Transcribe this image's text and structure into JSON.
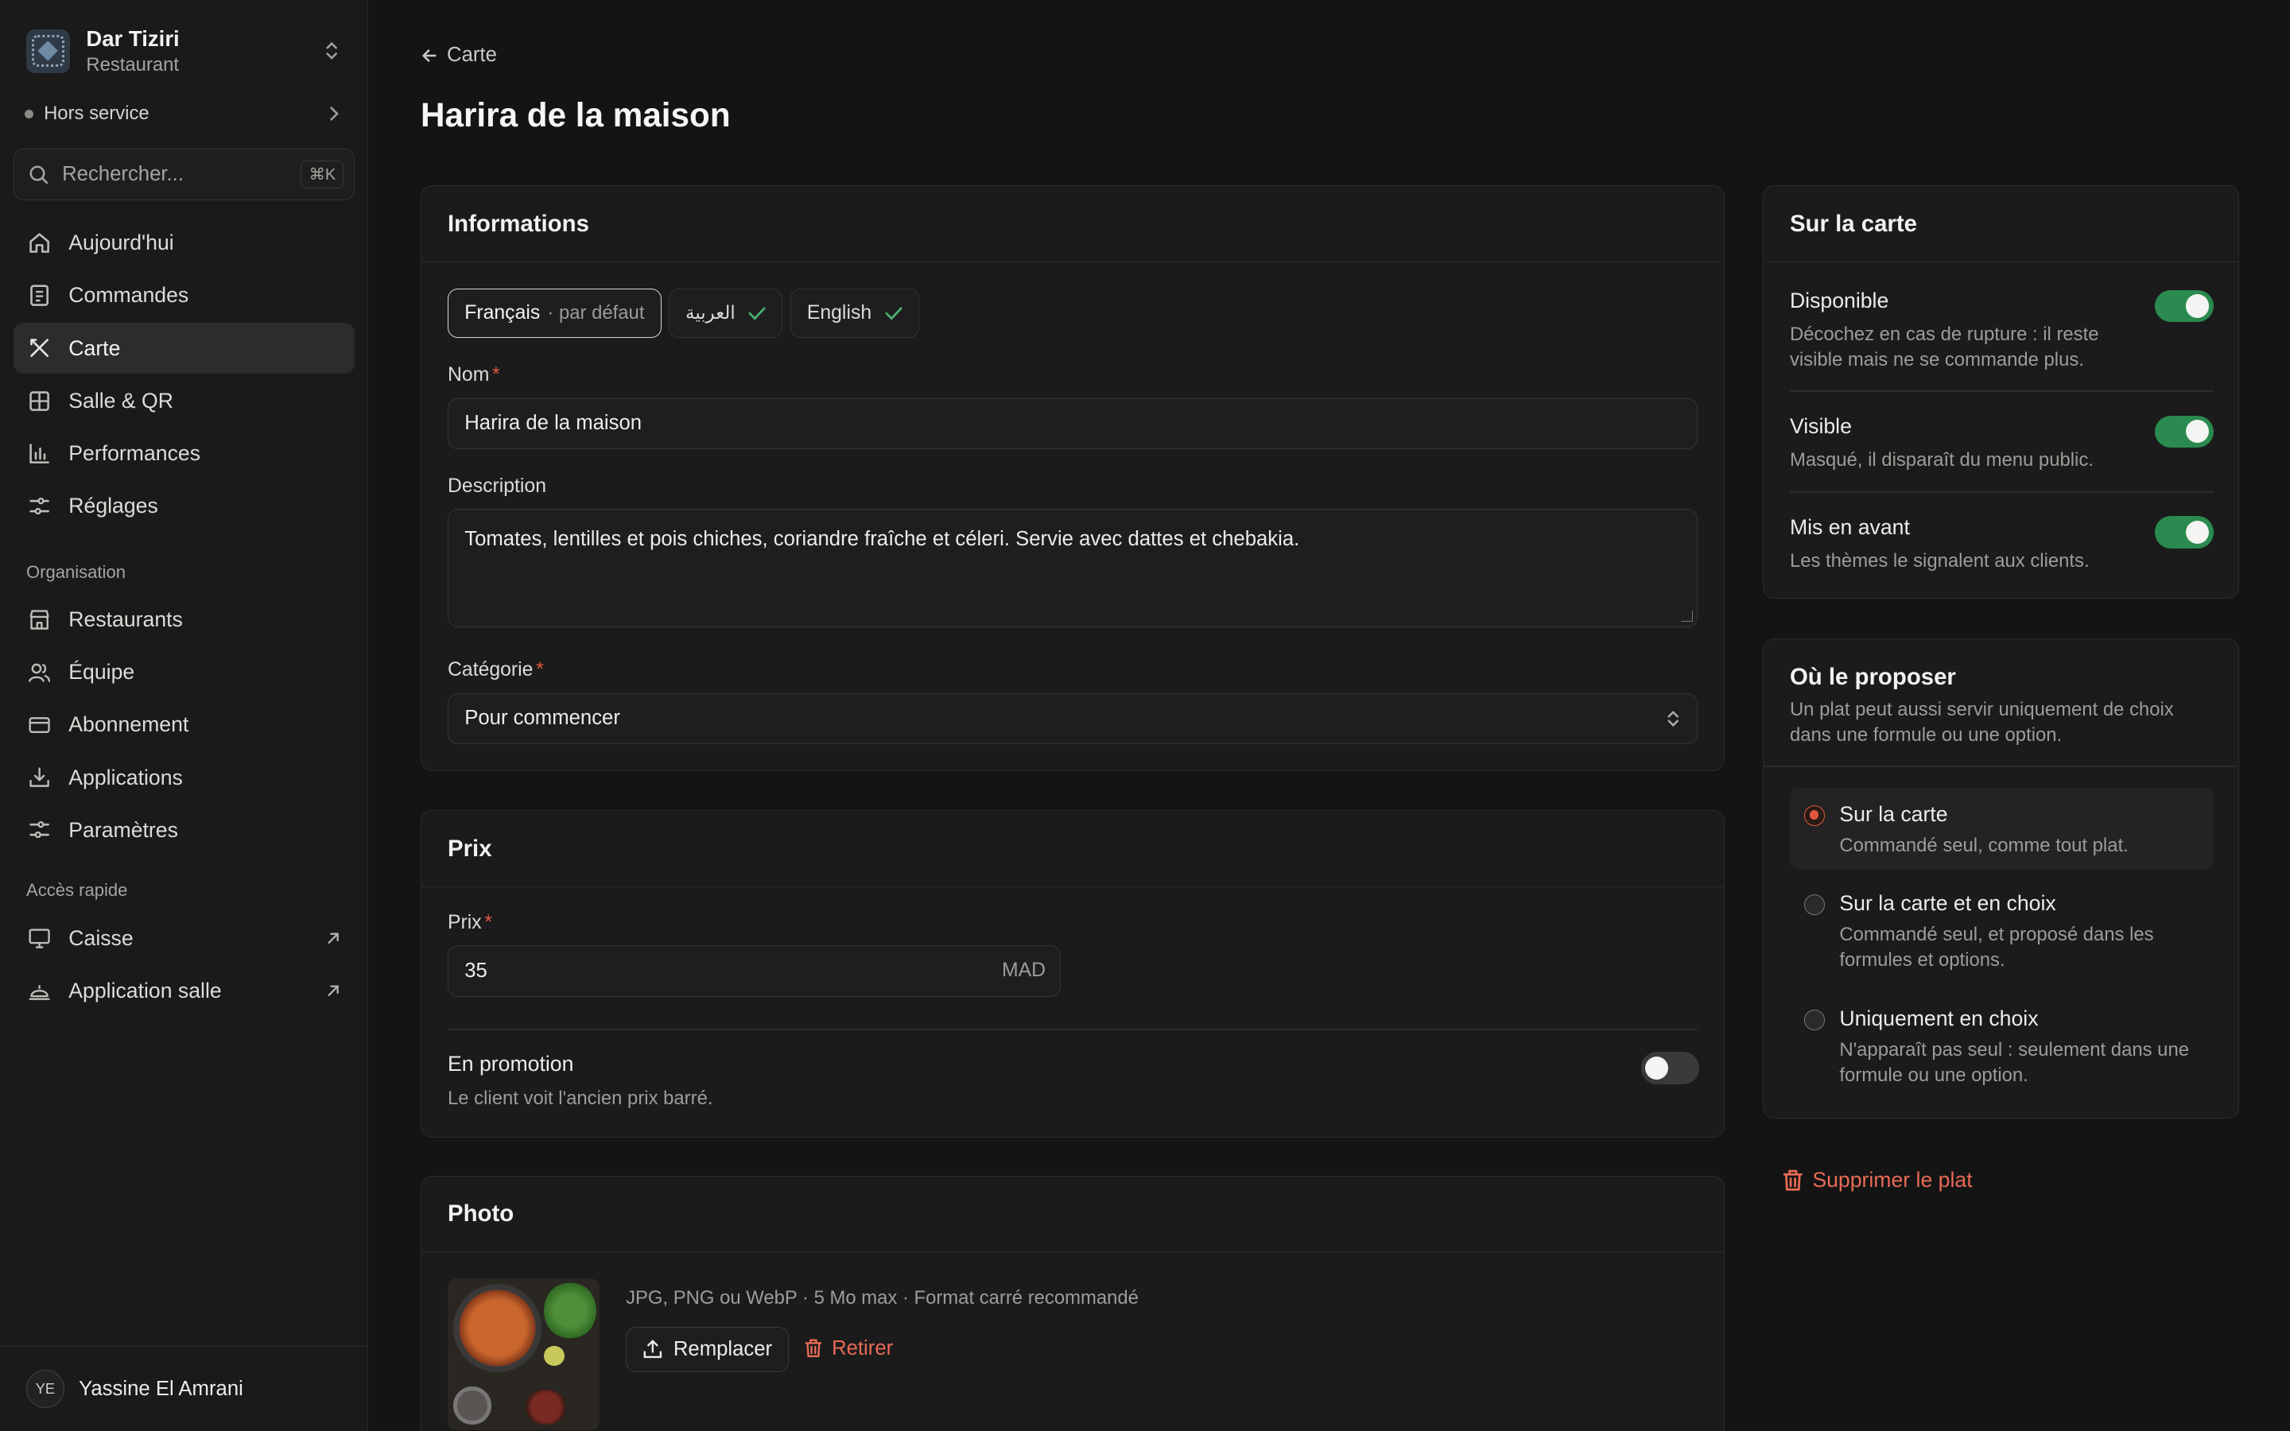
{
  "org": {
    "name": "Dar Tiziri",
    "type": "Restaurant"
  },
  "status": {
    "label": "Hors service"
  },
  "search": {
    "placeholder": "Rechercher...",
    "shortcut": "⌘K"
  },
  "nav": {
    "main": [
      {
        "label": "Aujourd'hui",
        "icon": "home-icon"
      },
      {
        "label": "Commandes",
        "icon": "receipt-icon"
      },
      {
        "label": "Carte",
        "icon": "utensils-icon",
        "active": true
      },
      {
        "label": "Salle & QR",
        "icon": "grid-icon"
      },
      {
        "label": "Performances",
        "icon": "chart-icon"
      },
      {
        "label": "Réglages",
        "icon": "sliders-icon"
      }
    ],
    "org_section": "Organisation",
    "org": [
      {
        "label": "Restaurants",
        "icon": "store-icon"
      },
      {
        "label": "Équipe",
        "icon": "users-icon"
      },
      {
        "label": "Abonnement",
        "icon": "card-icon"
      },
      {
        "label": "Applications",
        "icon": "download-icon"
      },
      {
        "label": "Paramètres",
        "icon": "settings-icon"
      }
    ],
    "quick_section": "Accès rapide",
    "quick": [
      {
        "label": "Caisse",
        "icon": "monitor-icon"
      },
      {
        "label": "Application salle",
        "icon": "cloche-icon"
      }
    ]
  },
  "user": {
    "initials": "YE",
    "name": "Yassine El Amrani"
  },
  "breadcrumb": {
    "back": "Carte"
  },
  "page": {
    "title": "Harira de la maison"
  },
  "info": {
    "title": "Informations",
    "langs": [
      {
        "label": "Français",
        "note": "· par défaut"
      },
      {
        "label": "العربية"
      },
      {
        "label": "English"
      }
    ],
    "name_label": "Nom",
    "name_value": "Harira de la maison",
    "desc_label": "Description",
    "desc_value": "Tomates, lentilles et pois chiches, coriandre fraîche et céleri. Servie avec dattes et chebakia.",
    "cat_label": "Catégorie",
    "cat_value": "Pour commencer"
  },
  "price": {
    "title": "Prix",
    "label": "Prix",
    "value": "35",
    "currency": "MAD",
    "promo_title": "En promotion",
    "promo_desc": "Le client voit l'ancien prix barré.",
    "promo_on": false
  },
  "photo": {
    "title": "Photo",
    "hint": "JPG, PNG ou WebP · 5 Mo max · Format carré recommandé",
    "replace": "Remplacer",
    "remove": "Retirer"
  },
  "on_menu": {
    "title": "Sur la carte",
    "rows": [
      {
        "title": "Disponible",
        "desc": "Décochez en cas de rupture : il reste visible mais ne se commande plus.",
        "on": true
      },
      {
        "title": "Visible",
        "desc": "Masqué, il disparaît du menu public.",
        "on": true
      },
      {
        "title": "Mis en avant",
        "desc": "Les thèmes le signalent aux clients.",
        "on": true
      }
    ]
  },
  "where": {
    "title": "Où le proposer",
    "desc": "Un plat peut aussi servir uniquement de choix dans une formule ou une option.",
    "options": [
      {
        "title": "Sur la carte",
        "desc": "Commandé seul, comme tout plat.",
        "selected": true
      },
      {
        "title": "Sur la carte et en choix",
        "desc": "Commandé seul, et proposé dans les formules et options.",
        "selected": false
      },
      {
        "title": "Uniquement en choix",
        "desc": "N'apparaît pas seul : seulement dans une formule ou une option.",
        "selected": false
      }
    ]
  },
  "delete": {
    "label": "Supprimer le plat"
  },
  "colors": {
    "accent": "#e0583f",
    "toggle_on": "#2a8a4f",
    "danger": "#e86a55"
  }
}
